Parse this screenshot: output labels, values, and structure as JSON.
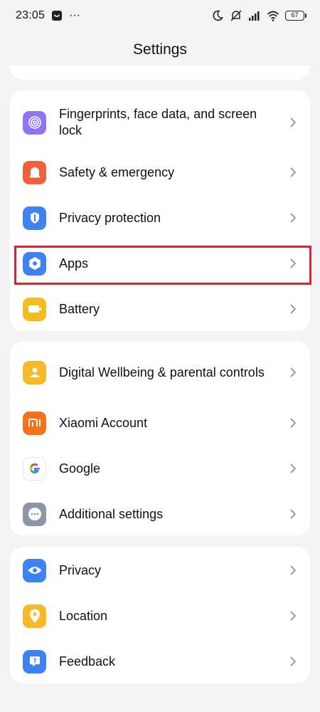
{
  "status_bar": {
    "time": "23:05",
    "more": "···",
    "battery": "67"
  },
  "header": {
    "title": "Settings"
  },
  "groups": [
    {
      "items": [
        {
          "label": "Fingerprints, face data, and screen lock",
          "icon": "fingerprint-icon",
          "color": "#8f74f5"
        },
        {
          "label": "Safety & emergency",
          "icon": "alarm-icon",
          "color": "#f0613a"
        },
        {
          "label": "Privacy protection",
          "icon": "shield-icon",
          "color": "#3e83f6"
        },
        {
          "label": "Apps",
          "icon": "apps-gear-icon",
          "color": "#3e83f6"
        },
        {
          "label": "Battery",
          "icon": "battery-icon",
          "color": "#f6bb1d"
        }
      ]
    },
    {
      "items": [
        {
          "label": "Digital Wellbeing & parental controls",
          "icon": "wellbeing-icon",
          "color": "#f6b928"
        },
        {
          "label": "Xiaomi Account",
          "icon": "mi-logo-icon",
          "color": "#f5721b"
        },
        {
          "label": "Google",
          "icon": "google-g-icon",
          "color": "#ffffff"
        },
        {
          "label": "Additional settings",
          "icon": "more-dots-icon",
          "color": "#8d95a8"
        }
      ]
    },
    {
      "items": [
        {
          "label": "Privacy",
          "icon": "eye-icon",
          "color": "#3e83f6"
        },
        {
          "label": "Location",
          "icon": "location-pin-icon",
          "color": "#f6b928"
        },
        {
          "label": "Feedback",
          "icon": "feedback-question-icon",
          "color": "#3e83f6"
        }
      ]
    }
  ],
  "highlight": {
    "target": "Apps",
    "color": "#d8252f"
  }
}
